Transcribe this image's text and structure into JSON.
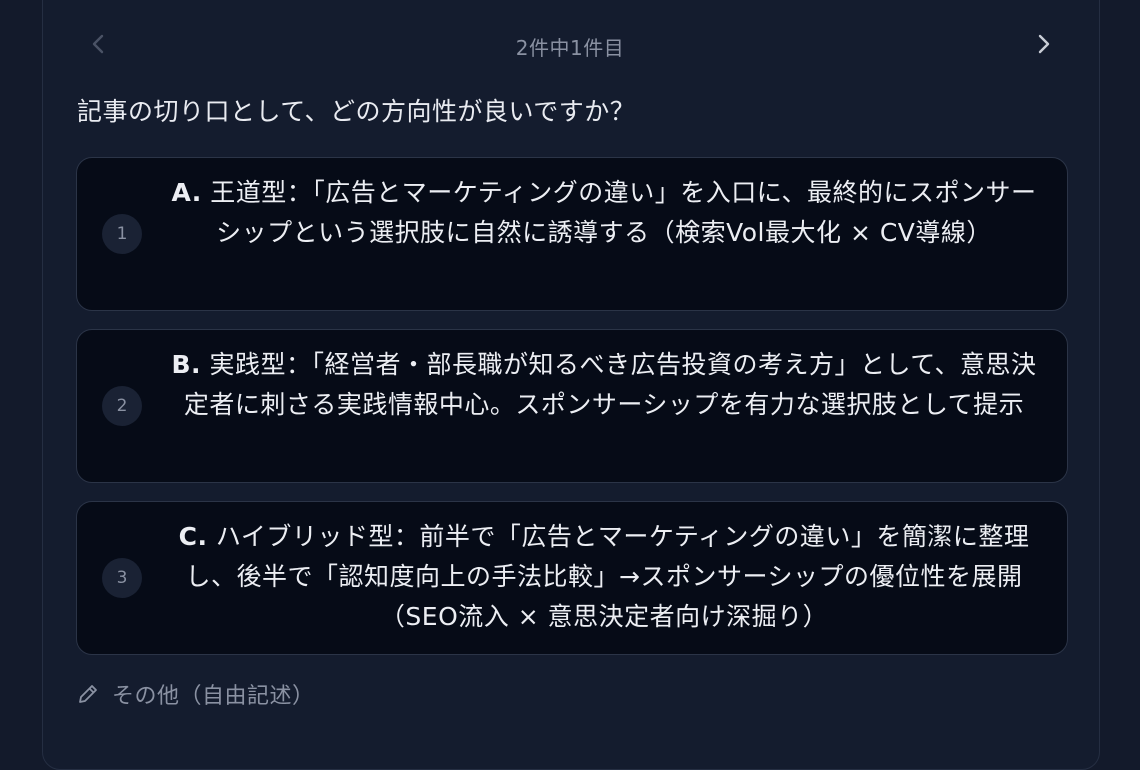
{
  "pager": {
    "counter": "2件中1件目",
    "prev_icon": "chevron-left-icon",
    "next_icon": "chevron-right-icon"
  },
  "question": "記事の切り口として、どの方向性が良いですか？",
  "options": [
    {
      "number": "1",
      "prefix": "A.",
      "text": " 王道型：「広告とマーケティングの違い」を入口に、最終的にスポンサーシップという選択肢に自然に誘導する（検索Vol最大化 × CV導線）"
    },
    {
      "number": "2",
      "prefix": "B.",
      "text": " 実践型：「経営者・部長職が知るべき広告投資の考え方」として、意思決定者に刺さる実践情報中心。スポンサーシップを有力な選択肢として提示"
    },
    {
      "number": "3",
      "prefix": "C.",
      "text": " ハイブリッド型：前半で「広告とマーケティングの違い」を簡潔に整理し、後半で「認知度向上の手法比較」→スポンサーシップの優位性を展開（SEO流入 × 意思決定者向け深掘り）"
    }
  ],
  "other": {
    "icon": "pencil-icon",
    "label": "その他（自由記述）"
  },
  "colors": {
    "background": "#131a2b",
    "card": "#060b17",
    "card_border": "#2b3447",
    "muted_text": "#8a91a2"
  }
}
